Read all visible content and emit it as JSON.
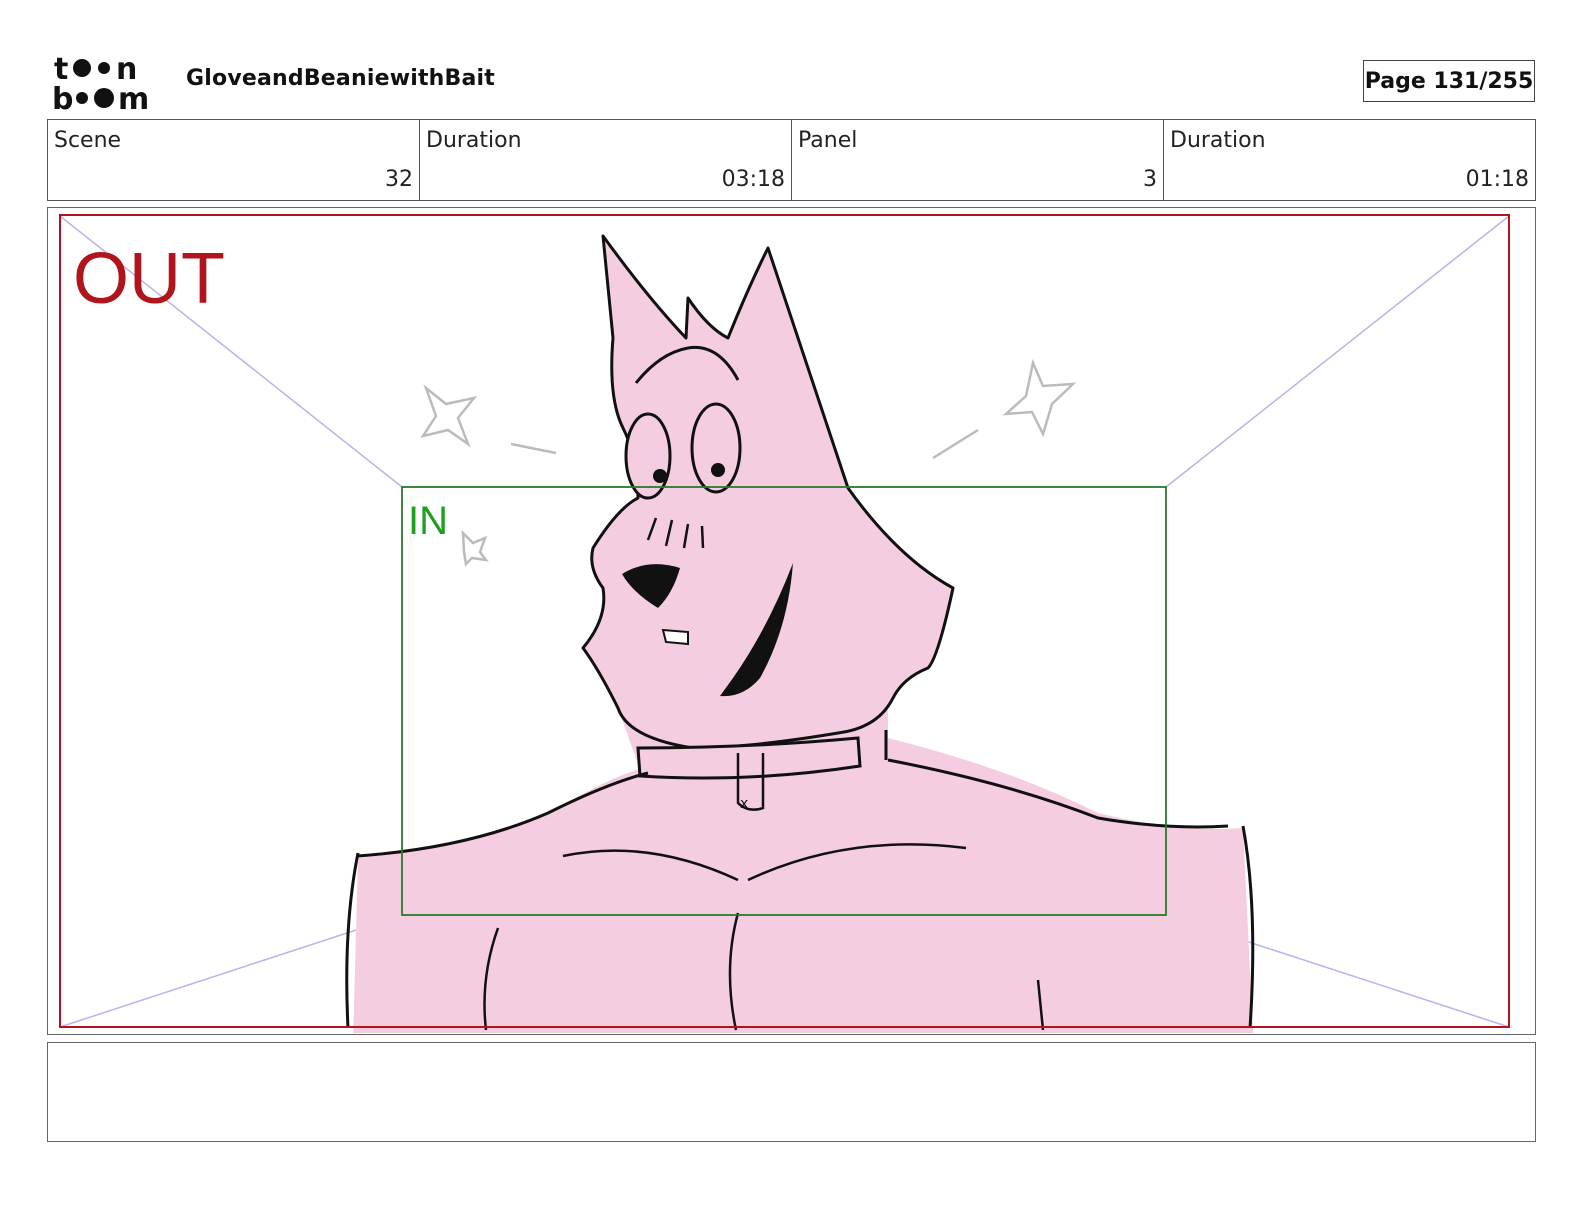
{
  "header": {
    "logo_text": "toon boom",
    "project_title": "GloveandBeaniewithBait",
    "page_label": "Page 131/255"
  },
  "info": {
    "scene_label": "Scene",
    "scene_value": "32",
    "scene_duration_label": "Duration",
    "scene_duration_value": "03:18",
    "panel_label": "Panel",
    "panel_value": "3",
    "panel_duration_label": "Duration",
    "panel_duration_value": "01:18"
  },
  "panel": {
    "out_label": "OUT",
    "in_label": "IN",
    "colors": {
      "out_frame": "#b0141c",
      "in_frame": "#2a7a2a",
      "in_text": "#1ea01e",
      "guide_lines": "#b8b4e8",
      "character_fill": "#f5cde0",
      "ink": "#111111"
    }
  },
  "notes": {
    "text": ""
  }
}
